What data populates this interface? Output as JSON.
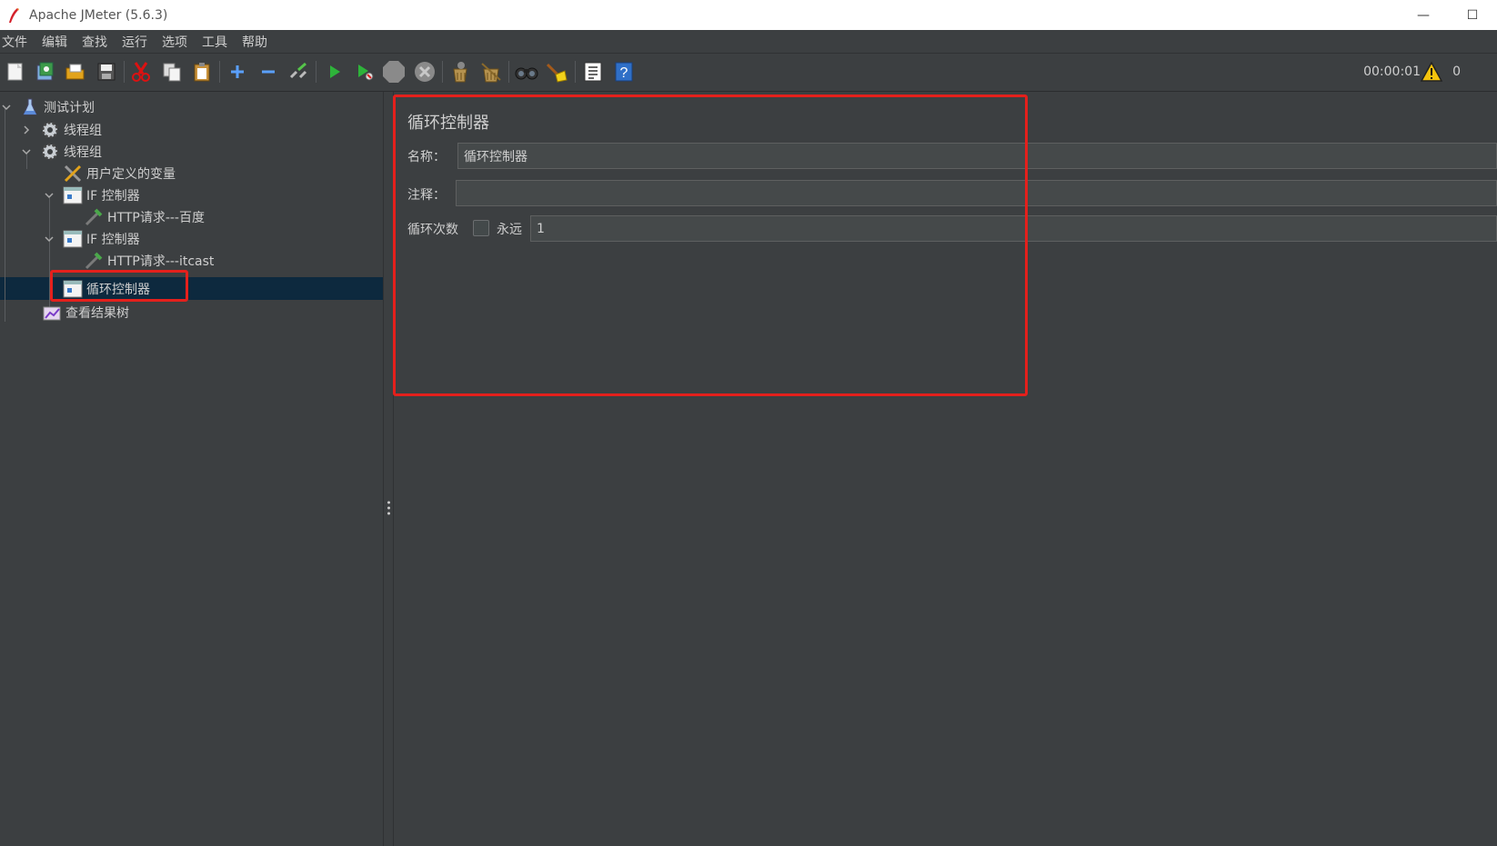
{
  "window": {
    "title": "Apache JMeter (5.6.3)",
    "minimize": "—",
    "maximize": "☐"
  },
  "menu": [
    "文件",
    "编辑",
    "查找",
    "运行",
    "选项",
    "工具",
    "帮助"
  ],
  "toolbar": {
    "buttons": [
      "new-icon",
      "templates-icon",
      "open-icon",
      "save-icon",
      "cut-icon",
      "copy-icon",
      "paste-icon",
      "expand-icon",
      "collapse-icon",
      "toggle-icon",
      "start-icon",
      "start-no-pause-icon",
      "stop-icon",
      "shutdown-icon",
      "clear-icon",
      "clear-all-icon",
      "search-icon",
      "reset-search-icon",
      "function-helper-icon",
      "help-icon"
    ],
    "elapsed": "00:00:01",
    "warnings": "0"
  },
  "tree": {
    "nodes": [
      {
        "label": "测试计划",
        "icon": "test-plan-icon"
      },
      {
        "label": "线程组",
        "icon": "thread-group-icon"
      },
      {
        "label": "线程组",
        "icon": "thread-group-icon"
      },
      {
        "label": "用户定义的变量",
        "icon": "variables-icon"
      },
      {
        "label": "IF 控制器",
        "icon": "controller-icon"
      },
      {
        "label": "HTTP请求---百度",
        "icon": "http-sampler-icon"
      },
      {
        "label": "IF 控制器",
        "icon": "controller-icon"
      },
      {
        "label": "HTTP请求---itcast",
        "icon": "http-sampler-icon"
      },
      {
        "label": "循环控制器",
        "icon": "controller-icon"
      },
      {
        "label": "查看结果树",
        "icon": "results-tree-icon"
      }
    ]
  },
  "panel": {
    "title": "循环控制器",
    "name_label": "名称：",
    "name_value": "循环控制器",
    "comment_label": "注释：",
    "comment_value": "",
    "loop_label": "循环次数",
    "forever_label": "永远",
    "forever_checked": false,
    "loop_value": "1"
  },
  "colors": {
    "background": "#3c3f41",
    "selection": "#0d293e",
    "highlight": "#e4201c"
  }
}
